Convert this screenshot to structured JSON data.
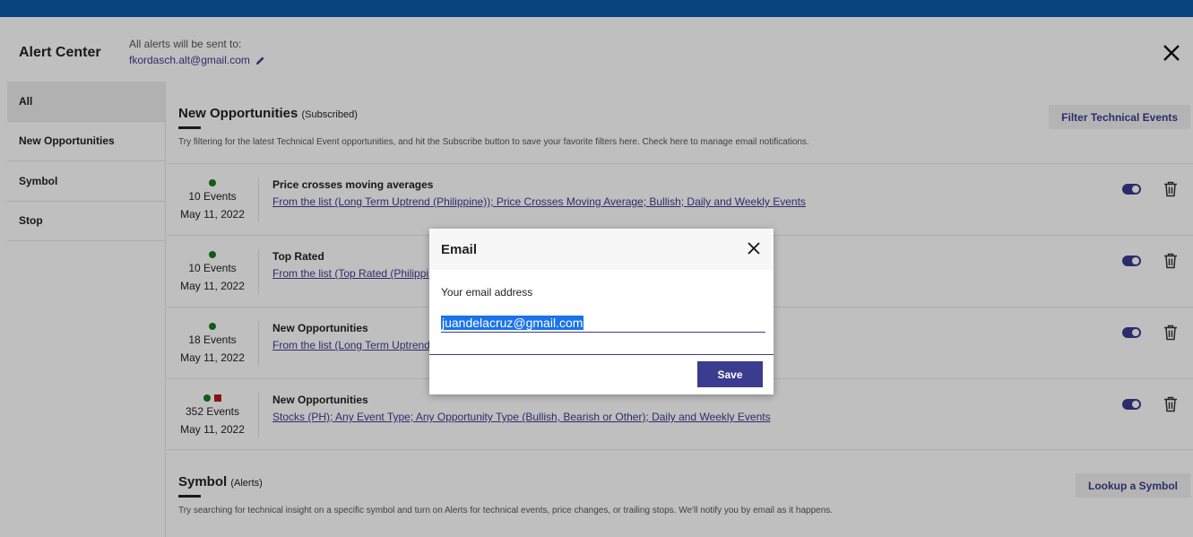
{
  "header": {
    "title": "Alert Center",
    "sent_to_label": "All alerts will be sent to:",
    "email": "fkordasch.alt@gmail.com"
  },
  "sidebar": {
    "items": [
      {
        "label": "All"
      },
      {
        "label": "New Opportunities"
      },
      {
        "label": "Symbol"
      },
      {
        "label": "Stop"
      }
    ]
  },
  "sections": {
    "opportunities": {
      "title": "New Opportunities",
      "subtitle": "(Subscribed)",
      "description": "Try filtering for the latest Technical Event opportunities, and hit the Subscribe button to save your favorite filters here. Check here to manage email notifications.",
      "button": "Filter Technical Events",
      "rows": [
        {
          "events": "10 Events",
          "date": "May 11, 2022",
          "title": "Price crosses moving averages",
          "link": "From the list (Long Term Uptrend (Philippine)); Price Crosses Moving Average; Bullish; Daily and Weekly Events"
        },
        {
          "events": "10 Events",
          "date": "May 11, 2022",
          "title": "Top Rated",
          "link": "From the list (Top Rated (Philippin"
        },
        {
          "events": "18 Events",
          "date": "May 11, 2022",
          "title": "New Opportunities",
          "link": "From the list (Long Term Uptrend"
        },
        {
          "events": "352 Events",
          "date": "May 11, 2022",
          "title": "New Opportunities",
          "link": "Stocks (PH); Any Event Type; Any Opportunity Type (Bullish, Bearish or Other); Daily and Weekly Events"
        }
      ]
    },
    "symbol": {
      "title": "Symbol",
      "subtitle": "(Alerts)",
      "description": "Try searching for technical insight on a specific symbol and turn on Alerts for technical events, price changes, or trailing stops. We'll notify you by email as it happens.",
      "button": "Lookup a Symbol"
    }
  },
  "modal": {
    "title": "Email",
    "label": "Your email address",
    "value": "juandelacruz@gmail.com",
    "save": "Save"
  },
  "colors": {
    "topbar": "#0a5bab",
    "accent": "#3b3b8f",
    "dot_green": "#1a7a1a",
    "square_red": "#b81c1c",
    "selection": "#1a73e8"
  }
}
